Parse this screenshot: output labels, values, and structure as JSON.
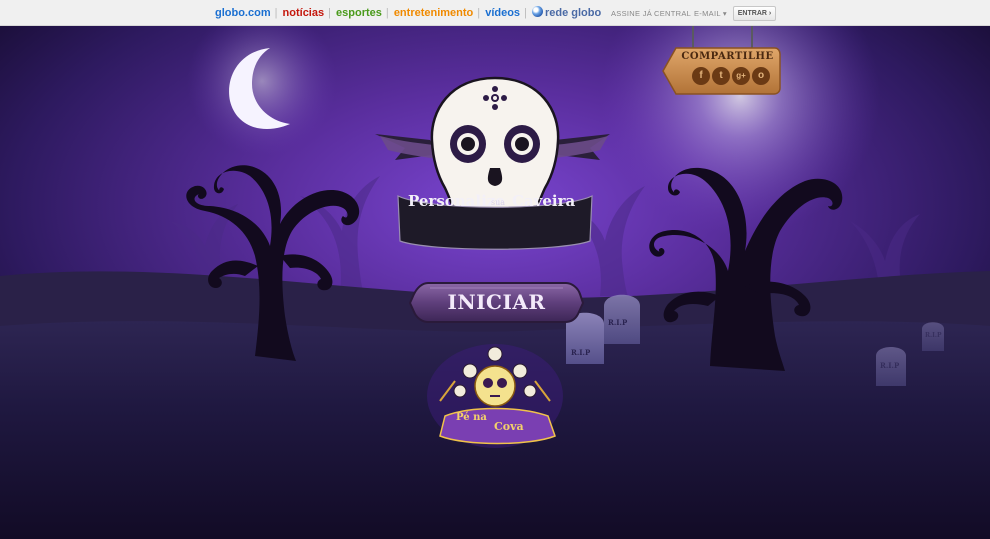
{
  "topbar": {
    "nav": [
      {
        "label": "globo.com",
        "cls": "c-globo"
      },
      {
        "label": "notícias",
        "cls": "c-noticias"
      },
      {
        "label": "esportes",
        "cls": "c-esportes"
      },
      {
        "label": "entretenimento",
        "cls": "c-entre"
      },
      {
        "label": "vídeos",
        "cls": "c-videos"
      }
    ],
    "rede_globo": "rede globo",
    "assine": "ASSINE JÁ",
    "central": "CENTRAL",
    "email": "E-MAIL",
    "entrar": "ENTRAR"
  },
  "banner": {
    "word1": "Personalize",
    "word2": "sua",
    "word3": "Caveira"
  },
  "start_button": "INICIAR",
  "share": {
    "label": "COMPARTILHE",
    "icons": [
      "facebook-icon",
      "twitter-icon",
      "google-plus-icon",
      "orkut-icon"
    ],
    "glyphs": [
      "f",
      "t",
      "g+",
      "o"
    ]
  },
  "tombstones": [
    "R.I.P",
    "R.I.P",
    "R.I.P",
    "R.I.P"
  ],
  "logo": {
    "line1": "Pé na",
    "line2": "Cova"
  },
  "colors": {
    "sky_top": "#1c1240",
    "sky_mid": "#5a2e9e",
    "glow": "#7a45d0",
    "ground": "#22193f",
    "banner": "#1e1a28",
    "button": "#6b4a86"
  }
}
